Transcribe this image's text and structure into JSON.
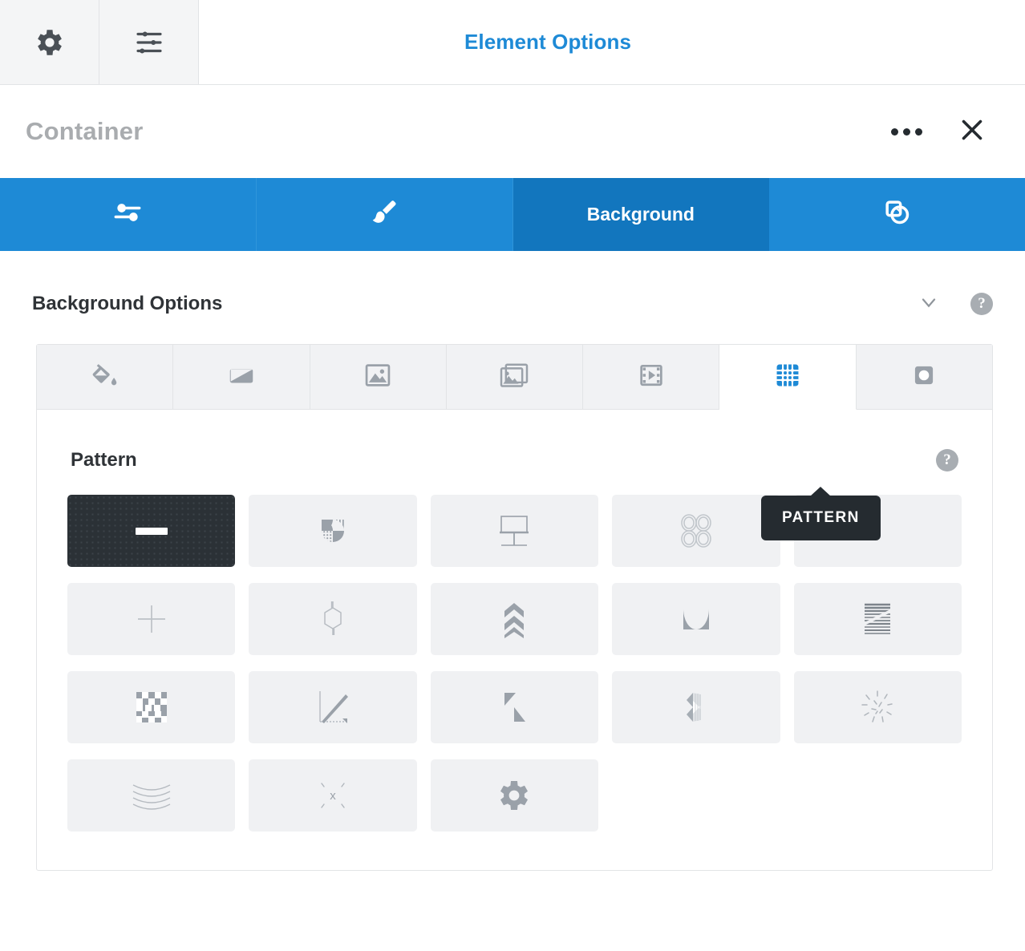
{
  "appbar": {
    "gear_icon": "gear-icon",
    "settings_icon": "sliders-settings-icon",
    "title": "Element Options"
  },
  "element_header": {
    "name": "Container",
    "more_icon": "ellipsis-icon",
    "close_icon": "close-icon"
  },
  "main_tabs": [
    {
      "label": "",
      "icon": "sliders-icon",
      "active": false
    },
    {
      "label": "",
      "icon": "paintbrush-icon",
      "active": false
    },
    {
      "label": "Background",
      "icon": "",
      "active": true
    },
    {
      "label": "",
      "icon": "shapes-clone-icon",
      "active": false
    }
  ],
  "section": {
    "title": "Background Options",
    "collapse_icon": "chevron-down-icon",
    "help_icon": "help-icon",
    "help_label": "?"
  },
  "sub_tabs": [
    {
      "name": "color",
      "icon": "paint-bucket-icon",
      "active": false
    },
    {
      "name": "gradient",
      "icon": "gradient-icon",
      "active": false
    },
    {
      "name": "image",
      "icon": "image-icon",
      "active": false
    },
    {
      "name": "slideshow",
      "icon": "images-stack-icon",
      "active": false
    },
    {
      "name": "video",
      "icon": "film-play-icon",
      "active": false
    },
    {
      "name": "pattern",
      "icon": "pattern-grid-icon",
      "active": true
    },
    {
      "name": "mask",
      "icon": "mask-shape-icon",
      "active": false
    }
  ],
  "pattern": {
    "label": "Pattern",
    "tooltip": "PATTERN",
    "help_label": "?",
    "help_icon": "help-icon",
    "tiles": [
      {
        "name": "pattern-none",
        "icon": "dash-icon",
        "selected": true
      },
      {
        "name": "pattern-quarters",
        "icon": "quarter-circles-icon",
        "selected": false
      },
      {
        "name": "pattern-bathroom",
        "icon": "table-stand-icon",
        "selected": false
      },
      {
        "name": "pattern-bubbles",
        "icon": "four-rings-icon",
        "selected": false
      },
      {
        "name": "pattern-dot",
        "icon": "tiny-dot-icon",
        "selected": false
      },
      {
        "name": "pattern-cross",
        "icon": "plus-cross-icon",
        "selected": false
      },
      {
        "name": "pattern-hexagon",
        "icon": "hexagon-icon",
        "selected": false
      },
      {
        "name": "pattern-chevrons",
        "icon": "chevrons-up-icon",
        "selected": false
      },
      {
        "name": "pattern-arches",
        "icon": "arch-curve-icon",
        "selected": false
      },
      {
        "name": "pattern-lines",
        "icon": "horizontal-lines-icon",
        "selected": false
      },
      {
        "name": "pattern-checker",
        "icon": "checkerboard-icon",
        "selected": false
      },
      {
        "name": "pattern-diagonal",
        "icon": "diagonal-line-icon",
        "selected": false
      },
      {
        "name": "pattern-triangles",
        "icon": "two-triangles-icon",
        "selected": false
      },
      {
        "name": "pattern-fan",
        "icon": "folded-fan-icon",
        "selected": false
      },
      {
        "name": "pattern-burst",
        "icon": "dashed-burst-icon",
        "selected": false
      },
      {
        "name": "pattern-waves",
        "icon": "wavy-lines-icon",
        "selected": false
      },
      {
        "name": "pattern-x",
        "icon": "x-sparkle-icon",
        "selected": false
      },
      {
        "name": "pattern-custom",
        "icon": "gear-icon",
        "selected": false
      }
    ]
  },
  "colors": {
    "accent_blue": "#1e8ad6",
    "accent_blue_active": "#1276be",
    "dark": "#252b30",
    "tile_bg": "#f0f1f3",
    "icon_gray": "#9aa1a9",
    "muted_text": "#a9acaf"
  }
}
